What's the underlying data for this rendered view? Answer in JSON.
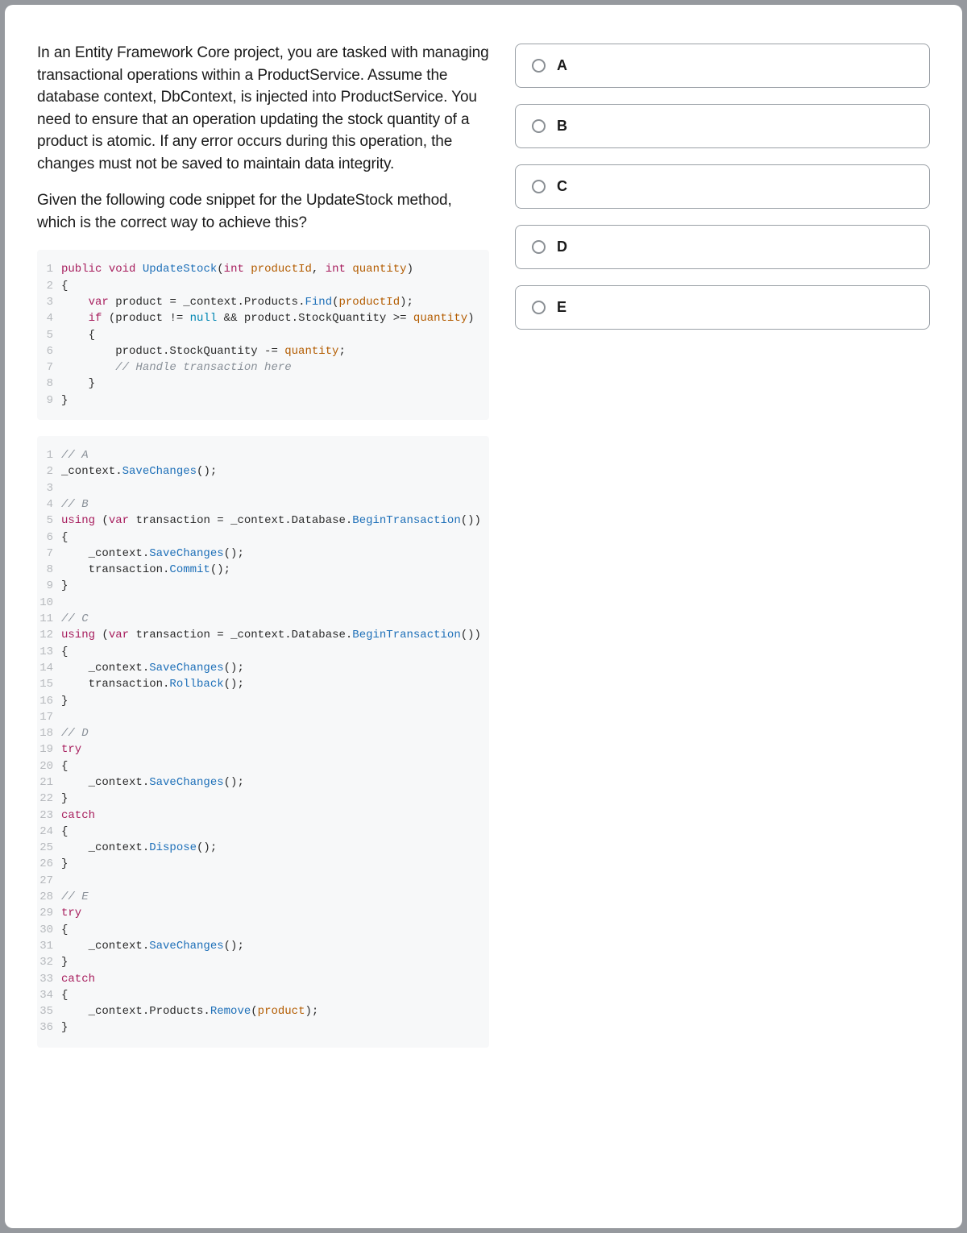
{
  "question": {
    "para1": "In an Entity Framework Core project, you are tasked with managing transactional operations within a ProductService. Assume the database context, DbContext, is injected into ProductService. You need to ensure that an operation updating the stock quantity of a product is atomic. If any error occurs during this operation, the changes must not be saved to maintain data integrity.",
    "para2": "Given the following code snippet for the UpdateStock method, which is the correct way to achieve this?"
  },
  "code1": {
    "lines": [
      {
        "n": "1",
        "tokens": [
          [
            "kw",
            "public"
          ],
          [
            "",
            ""
          ],
          [
            "kw",
            "void"
          ],
          [
            "",
            ""
          ],
          [
            "fn",
            "UpdateStock"
          ],
          [
            "",
            "("
          ],
          [
            "kw",
            "int"
          ],
          [
            "",
            ""
          ],
          [
            "param",
            "productId"
          ],
          [
            "",
            ","
          ],
          [
            "",
            ""
          ],
          [
            "kw",
            "int"
          ],
          [
            "",
            ""
          ],
          [
            "param",
            "quantity"
          ],
          [
            "",
            ")"
          ]
        ]
      },
      {
        "n": "2",
        "tokens": [
          [
            "",
            "{"
          ]
        ]
      },
      {
        "n": "3",
        "tokens": [
          [
            "",
            "    "
          ],
          [
            "kw",
            "var"
          ],
          [
            "",
            ""
          ],
          [
            "",
            "product = _context.Products."
          ],
          [
            "fn",
            "Find"
          ],
          [
            "",
            "("
          ],
          [
            "var",
            "productId"
          ],
          [
            "",
            ");"
          ]
        ]
      },
      {
        "n": "4",
        "tokens": [
          [
            "",
            "    "
          ],
          [
            "kw",
            "if"
          ],
          [
            "",
            ""
          ],
          [
            "",
            "(product != "
          ],
          [
            "null",
            "null"
          ],
          [
            "",
            ""
          ],
          [
            "",
            "&& product.StockQuantity >= "
          ],
          [
            "var",
            "quantity"
          ],
          [
            "",
            ")"
          ]
        ]
      },
      {
        "n": "5",
        "tokens": [
          [
            "",
            "    {"
          ]
        ]
      },
      {
        "n": "6",
        "tokens": [
          [
            "",
            "        product.StockQuantity -= "
          ],
          [
            "var",
            "quantity"
          ],
          [
            "",
            ";"
          ]
        ]
      },
      {
        "n": "7",
        "tokens": [
          [
            "",
            "        "
          ],
          [
            "comment",
            "// Handle transaction here"
          ]
        ]
      },
      {
        "n": "8",
        "tokens": [
          [
            "",
            "    }"
          ]
        ]
      },
      {
        "n": "9",
        "tokens": [
          [
            "",
            "}"
          ]
        ]
      }
    ]
  },
  "code2": {
    "lines": [
      {
        "n": "1",
        "tokens": [
          [
            "comment",
            "// A"
          ]
        ]
      },
      {
        "n": "2",
        "tokens": [
          [
            "",
            "_context."
          ],
          [
            "fn",
            "SaveChanges"
          ],
          [
            "",
            "();"
          ]
        ]
      },
      {
        "n": "3",
        "tokens": [
          [
            "",
            ""
          ]
        ]
      },
      {
        "n": "4",
        "tokens": [
          [
            "comment",
            "// B"
          ]
        ]
      },
      {
        "n": "5",
        "tokens": [
          [
            "kw",
            "using"
          ],
          [
            "",
            ""
          ],
          [
            "",
            "("
          ],
          [
            "kw",
            "var"
          ],
          [
            "",
            ""
          ],
          [
            "",
            "transaction = _context.Database."
          ],
          [
            "fn",
            "BeginTransaction"
          ],
          [
            "",
            "())"
          ]
        ]
      },
      {
        "n": "6",
        "tokens": [
          [
            "",
            "{"
          ]
        ]
      },
      {
        "n": "7",
        "tokens": [
          [
            "",
            "    _context."
          ],
          [
            "fn",
            "SaveChanges"
          ],
          [
            "",
            "();"
          ]
        ]
      },
      {
        "n": "8",
        "tokens": [
          [
            "",
            "    transaction."
          ],
          [
            "fn",
            "Commit"
          ],
          [
            "",
            "();"
          ]
        ]
      },
      {
        "n": "9",
        "tokens": [
          [
            "",
            "}"
          ]
        ]
      },
      {
        "n": "10",
        "tokens": [
          [
            "",
            ""
          ]
        ]
      },
      {
        "n": "11",
        "tokens": [
          [
            "comment",
            "// C"
          ]
        ]
      },
      {
        "n": "12",
        "tokens": [
          [
            "kw",
            "using"
          ],
          [
            "",
            ""
          ],
          [
            "",
            "("
          ],
          [
            "kw",
            "var"
          ],
          [
            "",
            ""
          ],
          [
            "",
            "transaction = _context.Database."
          ],
          [
            "fn",
            "BeginTransaction"
          ],
          [
            "",
            "())"
          ]
        ]
      },
      {
        "n": "13",
        "tokens": [
          [
            "",
            "{"
          ]
        ]
      },
      {
        "n": "14",
        "tokens": [
          [
            "",
            "    _context."
          ],
          [
            "fn",
            "SaveChanges"
          ],
          [
            "",
            "();"
          ]
        ]
      },
      {
        "n": "15",
        "tokens": [
          [
            "",
            "    transaction."
          ],
          [
            "fn",
            "Rollback"
          ],
          [
            "",
            "();"
          ]
        ]
      },
      {
        "n": "16",
        "tokens": [
          [
            "",
            "}"
          ]
        ]
      },
      {
        "n": "17",
        "tokens": [
          [
            "",
            ""
          ]
        ]
      },
      {
        "n": "18",
        "tokens": [
          [
            "comment",
            "// D"
          ]
        ]
      },
      {
        "n": "19",
        "tokens": [
          [
            "kw",
            "try"
          ]
        ]
      },
      {
        "n": "20",
        "tokens": [
          [
            "",
            "{"
          ]
        ]
      },
      {
        "n": "21",
        "tokens": [
          [
            "",
            "    _context."
          ],
          [
            "fn",
            "SaveChanges"
          ],
          [
            "",
            "();"
          ]
        ]
      },
      {
        "n": "22",
        "tokens": [
          [
            "",
            "}"
          ]
        ]
      },
      {
        "n": "23",
        "tokens": [
          [
            "kw",
            "catch"
          ]
        ]
      },
      {
        "n": "24",
        "tokens": [
          [
            "",
            "{"
          ]
        ]
      },
      {
        "n": "25",
        "tokens": [
          [
            "",
            "    _context."
          ],
          [
            "fn",
            "Dispose"
          ],
          [
            "",
            "();"
          ]
        ]
      },
      {
        "n": "26",
        "tokens": [
          [
            "",
            "}"
          ]
        ]
      },
      {
        "n": "27",
        "tokens": [
          [
            "",
            ""
          ]
        ]
      },
      {
        "n": "28",
        "tokens": [
          [
            "comment",
            "// E"
          ]
        ]
      },
      {
        "n": "29",
        "tokens": [
          [
            "kw",
            "try"
          ]
        ]
      },
      {
        "n": "30",
        "tokens": [
          [
            "",
            "{"
          ]
        ]
      },
      {
        "n": "31",
        "tokens": [
          [
            "",
            "    _context."
          ],
          [
            "fn",
            "SaveChanges"
          ],
          [
            "",
            "();"
          ]
        ]
      },
      {
        "n": "32",
        "tokens": [
          [
            "",
            "}"
          ]
        ]
      },
      {
        "n": "33",
        "tokens": [
          [
            "kw",
            "catch"
          ]
        ]
      },
      {
        "n": "34",
        "tokens": [
          [
            "",
            "{"
          ]
        ]
      },
      {
        "n": "35",
        "tokens": [
          [
            "",
            "    _context.Products."
          ],
          [
            "fn",
            "Remove"
          ],
          [
            "",
            "("
          ],
          [
            "var",
            "product"
          ],
          [
            "",
            ");"
          ]
        ]
      },
      {
        "n": "36",
        "tokens": [
          [
            "",
            "}"
          ]
        ]
      }
    ]
  },
  "options": [
    {
      "label": "A"
    },
    {
      "label": "B"
    },
    {
      "label": "C"
    },
    {
      "label": "D"
    },
    {
      "label": "E"
    }
  ]
}
